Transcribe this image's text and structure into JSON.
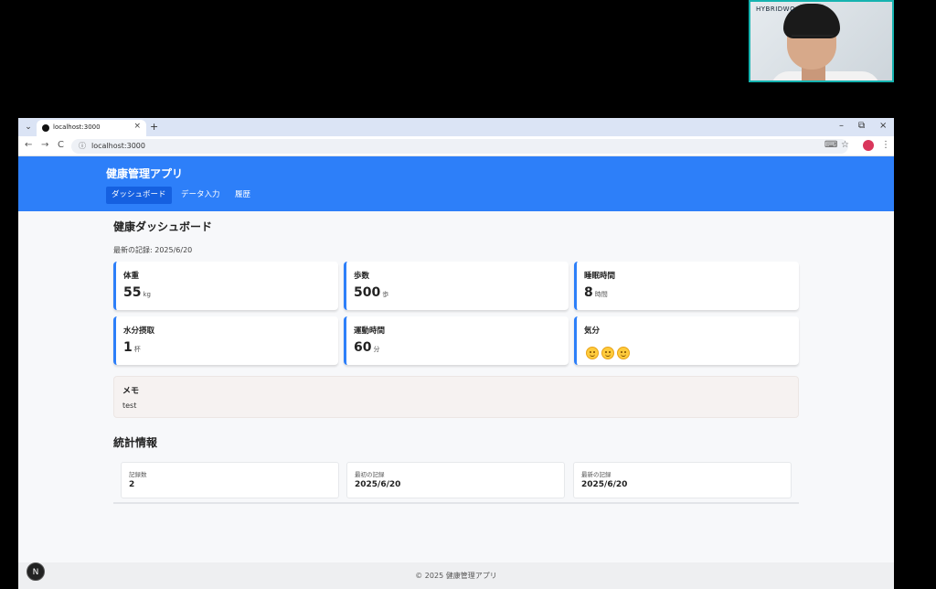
{
  "browser": {
    "tab_title": "localhost:3000",
    "tab_close": "×",
    "new_tab": "+",
    "url": "localhost:3000",
    "back": "←",
    "forward": "→",
    "reload": "C",
    "info": "ⓘ",
    "minimize": "–",
    "restore": "⧉",
    "close": "×",
    "tab_menu": "⌄",
    "translate_icon": "⌨",
    "star": "☆",
    "menu": "⋮"
  },
  "webcam": {
    "overlay_text": "HYBRIDWO"
  },
  "header": {
    "title": "健康管理アプリ",
    "nav": [
      {
        "label": "ダッシュボード",
        "active": true
      },
      {
        "label": "データ入力",
        "active": false
      },
      {
        "label": "履歴",
        "active": false
      }
    ]
  },
  "dashboard": {
    "title": "健康ダッシュボード",
    "latest_record": "最新の記録: 2025/6/20",
    "cards": [
      {
        "label": "体重",
        "value": "55",
        "unit": "kg"
      },
      {
        "label": "歩数",
        "value": "500",
        "unit": "歩"
      },
      {
        "label": "睡眠時間",
        "value": "8",
        "unit": "時間"
      },
      {
        "label": "水分摂取",
        "value": "1",
        "unit": "杯"
      },
      {
        "label": "運動時間",
        "value": "60",
        "unit": "分"
      },
      {
        "label": "気分",
        "mood_icons": [
          "smiling-face-icon",
          "smiling-face-icon",
          "smiling-face-icon"
        ],
        "mood_level": 3
      }
    ],
    "memo": {
      "title": "メモ",
      "text": "test"
    }
  },
  "stats": {
    "title": "統計情報",
    "items": [
      {
        "label": "記録数",
        "value": "2"
      },
      {
        "label": "最初の記録",
        "value": "2025/6/20"
      },
      {
        "label": "最新の記録",
        "value": "2025/6/20"
      }
    ]
  },
  "footer": {
    "text": "© 2025 健康管理アプリ",
    "badge": "N"
  },
  "colors": {
    "primary": "#2d7ff9",
    "active_nav": "#1560e0",
    "memo_bg": "#f6f2f1"
  }
}
